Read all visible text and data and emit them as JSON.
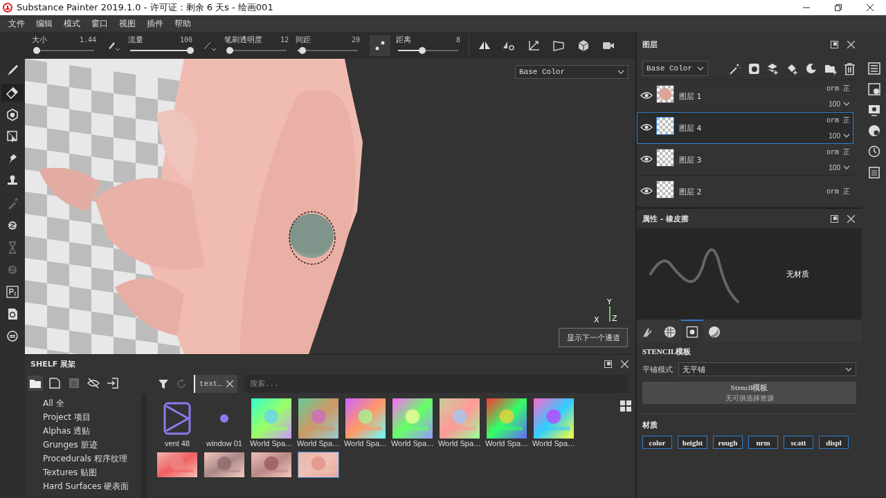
{
  "window": {
    "title": "Substance Painter 2019.1.0 - 许可证：剩余 6 天s - 绘画001"
  },
  "menu": [
    "文件",
    "编辑",
    "模式",
    "窗口",
    "视图",
    "插件",
    "帮助"
  ],
  "toolbar": {
    "sliders": [
      {
        "label": "大小",
        "reading": "1.44",
        "level": 0.05
      },
      {
        "label": "流量",
        "reading": "100",
        "level": 1
      },
      {
        "label": "笔刷透明度",
        "reading": "12",
        "level": 0.06
      },
      {
        "label": "间距",
        "reading": "20",
        "level": 0.08
      },
      {
        "label": "距离",
        "reading": "8",
        "level": 0.4
      }
    ]
  },
  "tools": [
    {
      "selected": false
    },
    {
      "selected": true
    },
    {
      "selected": false
    },
    {
      "selected": false
    },
    {
      "selected": false
    },
    {
      "selected": false
    },
    {
      "selected": false
    },
    {
      "selected": false
    },
    {
      "selected": false
    },
    {
      "selected": false
    },
    {
      "selected": false
    },
    {
      "selected": false
    },
    {
      "selected": false
    }
  ],
  "viewport": {
    "channel": "Base Color",
    "axes": [
      "Y",
      "X",
      "Z"
    ],
    "next_channel_button": "显示下一个通道"
  },
  "layers_panel": {
    "title": "图层",
    "channel": "Base Color",
    "layers": [
      {
        "name": "图层 1",
        "blend_channel": "orm",
        "blend": "正",
        "opacity": "100",
        "selected": false
      },
      {
        "name": "图层 4",
        "blend_channel": "orm",
        "blend": "正",
        "opacity": "100",
        "selected": true
      },
      {
        "name": "图层 3",
        "blend_channel": "orm",
        "blend": "正",
        "opacity": "100",
        "selected": false
      },
      {
        "name": "图层 2",
        "blend_channel": "orm",
        "blend": "正",
        "selected": false
      }
    ]
  },
  "properties_panel": {
    "title": "属性 - 橡皮擦",
    "preview_text": "无材质",
    "tabs": [
      {
        "selected": false
      },
      {
        "selected": false
      },
      {
        "selected": true
      },
      {
        "selected": false
      }
    ],
    "section_title": "STENCIL模板",
    "tiling_label": "平铺模式",
    "tiling_value": "无平铺",
    "stencil_button": {
      "title": "Stencil模板",
      "subtitle": "无可供选择资源"
    },
    "material_title": "材质",
    "channels": [
      {
        "label": "color",
        "on": true
      },
      {
        "label": "height",
        "on": true
      },
      {
        "label": "rough",
        "on": true
      },
      {
        "label": "nrm",
        "on": true
      },
      {
        "label": "scatt",
        "on": true
      },
      {
        "label": "displ",
        "on": true
      }
    ]
  },
  "shelf": {
    "title": "SHELF 展架",
    "tag": "text…",
    "search_placeholder": "搜索...",
    "categories": [
      "All 全",
      "Project 项目",
      "Alphas 透贴",
      "Grunges 脏迹",
      "Procedurals 程序纹理",
      "Textures 贴图",
      "Hard Surfaces 硬表面"
    ],
    "assets": [
      {
        "label": "vent 48",
        "kind": "vent"
      },
      {
        "label": "window 01",
        "kind": "dot"
      },
      {
        "label": "World Spa…",
        "kind": "picture"
      },
      {
        "label": "World Spa…",
        "kind": "picture"
      },
      {
        "label": "World Spa…",
        "kind": "picture"
      },
      {
        "label": "World Spa…",
        "kind": "picture"
      },
      {
        "label": "World Spa…",
        "kind": "picture"
      },
      {
        "label": "World Spa…",
        "kind": "picture"
      },
      {
        "label": "World Spa…",
        "kind": "picture"
      }
    ],
    "assets_row2": [
      {
        "kind": "picture",
        "selected": false
      },
      {
        "kind": "picture",
        "selected": false
      },
      {
        "kind": "picture",
        "selected": false
      },
      {
        "kind": "picture",
        "selected": true
      }
    ]
  }
}
